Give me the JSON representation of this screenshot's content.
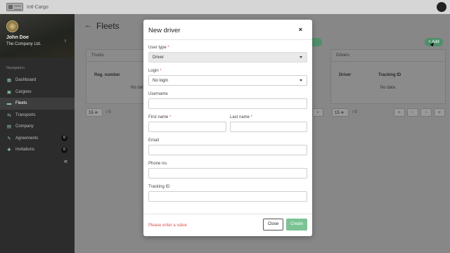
{
  "app": {
    "title": "Intl-Cargo"
  },
  "profile": {
    "name": "John Doe",
    "company": "The Company Ltd."
  },
  "nav": {
    "title": "Navigation",
    "items": [
      {
        "label": "Dashboard",
        "icon": "dashboard-icon",
        "glyph": "▦"
      },
      {
        "label": "Cargoes",
        "icon": "cargo-icon",
        "glyph": "▣"
      },
      {
        "label": "Fleets",
        "icon": "truck-icon",
        "glyph": "▬"
      },
      {
        "label": "Transports",
        "icon": "transport-icon",
        "glyph": "⇆"
      },
      {
        "label": "Company",
        "icon": "building-icon",
        "glyph": "▤"
      },
      {
        "label": "Agreements",
        "icon": "agreement-icon",
        "glyph": "✎",
        "badge": "0"
      },
      {
        "label": "Invitations",
        "icon": "user-plus-icon",
        "glyph": "✚",
        "badge": "0"
      }
    ],
    "collapse_glyph": "«"
  },
  "page": {
    "title": "Fleets",
    "back_glyph": "←",
    "add_label": "+ Add"
  },
  "trucks_panel": {
    "title": "Trucks",
    "columns": [
      "Reg. number"
    ],
    "empty": "No data",
    "page_size": "15 ≑",
    "page_of": "/ 0"
  },
  "drivers_panel": {
    "title": "Drivers",
    "columns": [
      "Driver",
      "Tracking ID"
    ],
    "empty": "No data",
    "page_size": "15 ≑",
    "page_of": "/ 0",
    "pager": [
      "«",
      "‹",
      "›",
      "»"
    ]
  },
  "hidden_pager_fragment": "«",
  "modal": {
    "title": "New driver",
    "close_glyph": "×",
    "fields": {
      "user_type": {
        "label": "User type",
        "required": "*",
        "value": "Driver"
      },
      "login": {
        "label": "Login",
        "required": "*",
        "value": "No login"
      },
      "username": {
        "label": "Username",
        "value": ""
      },
      "first_name": {
        "label": "First name",
        "required": "*",
        "value": ""
      },
      "last_name": {
        "label": "Last name",
        "required": "*",
        "value": ""
      },
      "email": {
        "label": "Email",
        "value": ""
      },
      "phone": {
        "label": "Phone no.",
        "value": ""
      },
      "tracking_id": {
        "label": "Tracking ID",
        "value": ""
      }
    },
    "error": "Please enter a value",
    "close_label": "Close",
    "create_label": "Create"
  },
  "colors": {
    "accent": "#4f8f6a",
    "create": "#7cc394",
    "error": "#d9534f",
    "sidebar": "#2c2c2c"
  }
}
